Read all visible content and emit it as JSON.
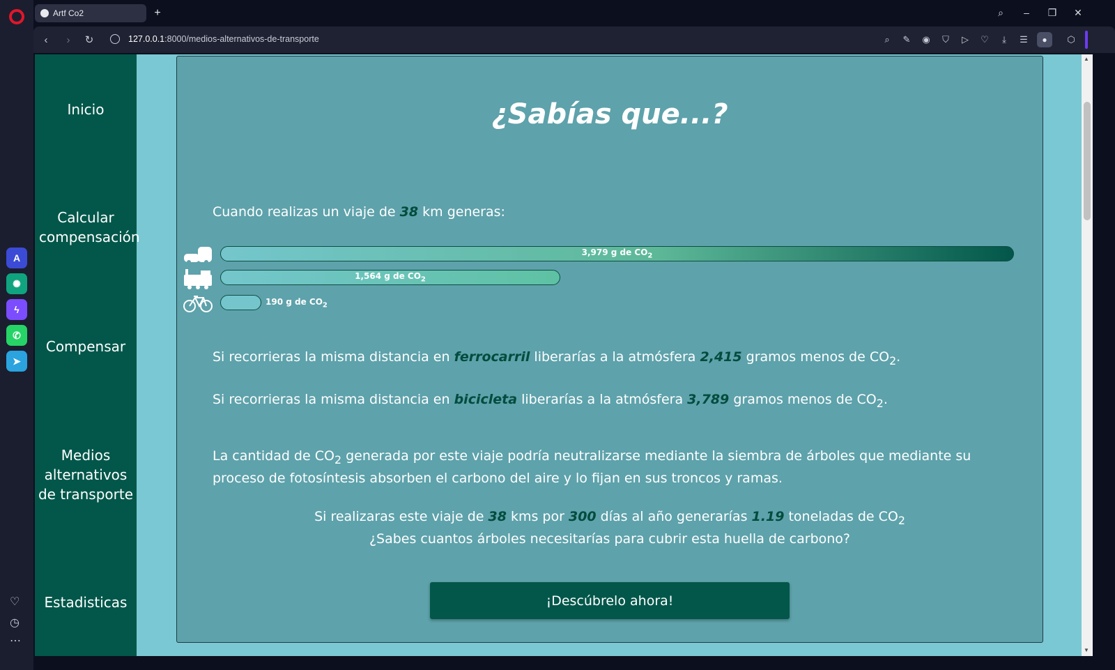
{
  "browser": {
    "tab_title": "Artf Co2",
    "url_host": "127.0.0.1",
    "url_path": ":8000/medios-alternativos-de-transporte"
  },
  "sidebar": {
    "items": [
      {
        "label": "Inicio"
      },
      {
        "label": "Calcular compensación"
      },
      {
        "label": "Compensar"
      },
      {
        "label": "Medios alternativos de transporte"
      },
      {
        "label": "Estadisticas"
      }
    ]
  },
  "main": {
    "title": "¿Sabías que...?",
    "intro_prefix": "Cuando realizas un viaje de ",
    "distance_km": "38",
    "intro_suffix": " km generas:",
    "emissions": [
      {
        "mode": "car",
        "icon": "car-icon",
        "value_g": 3979,
        "label": "3,979 g de CO"
      },
      {
        "mode": "train",
        "icon": "train-icon",
        "value_g": 1564,
        "label": "1,564 g de CO"
      },
      {
        "mode": "bike",
        "icon": "bicycle-icon",
        "value_g": 190,
        "label": "190 g de CO"
      }
    ],
    "train_sentence": {
      "p1": "Si recorrieras la misma distancia en ",
      "mode": "ferrocarril",
      "p2": " liberarías a la atmósfera ",
      "amount": "2,415",
      "p3": " gramos menos de CO",
      "end": "."
    },
    "bike_sentence": {
      "p1": "Si recorrieras la misma distancia en ",
      "mode": "bicicleta",
      "p2": " liberarías a la atmósfera ",
      "amount": "3,789",
      "p3": " gramos menos de CO",
      "end": "."
    },
    "trees_paragraph": {
      "p1": "La cantidad de CO",
      "p2": " generada por este viaje podría neutralizarse mediante la siembra de árboles que mediante su proceso de fotosíntesis absorben el carbono del aire y lo fijan en sus troncos y ramas."
    },
    "yearly": {
      "p1": "Si realizaras este viaje de ",
      "km": "38",
      "p2": " kms por ",
      "days": "300",
      "p3": " días al año generarías ",
      "tons": "1.19",
      "p4": " toneladas de CO",
      "question": "¿Sabes cuantos árboles necesitarías para cubrir esta huella de carbono?"
    },
    "cta_label": "¡Descúbrelo ahora!"
  },
  "subscript_two": "2"
}
